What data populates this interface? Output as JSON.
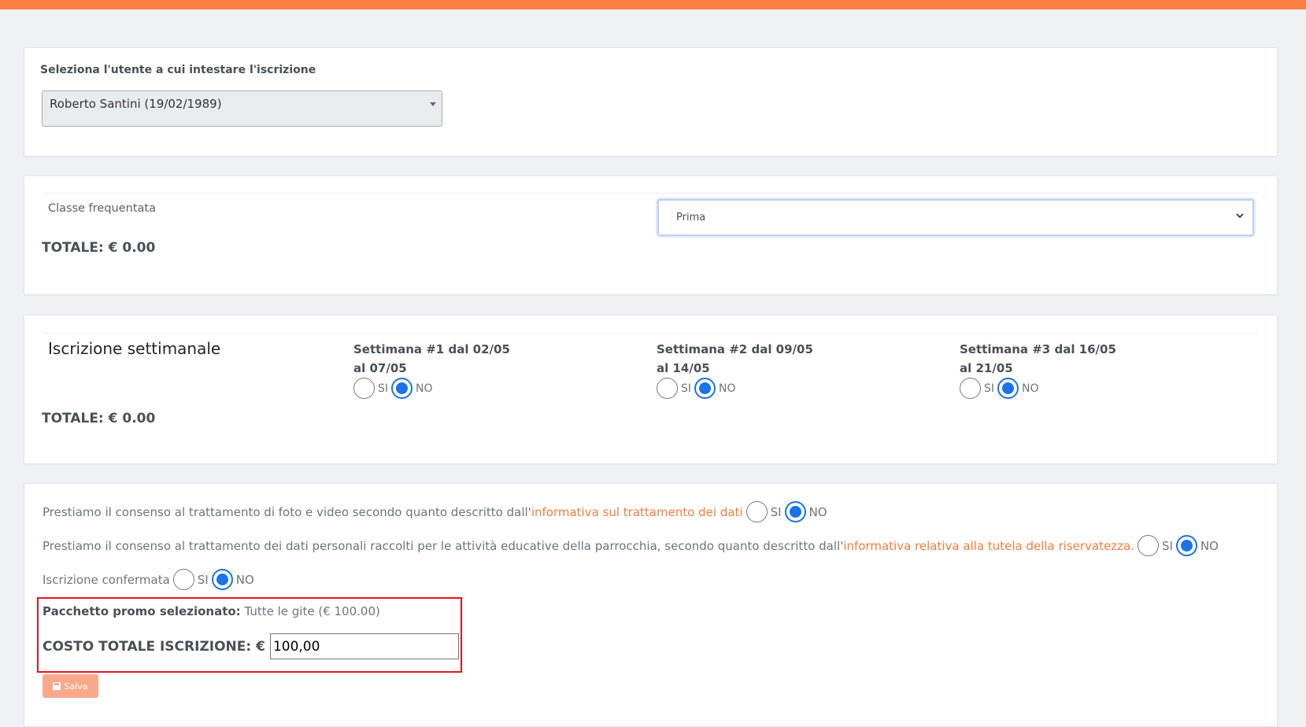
{
  "header": {
    "accent": "#fd7e42"
  },
  "user_section": {
    "label": "Seleziona l'utente a cui intestare l'iscrizione",
    "selected_user": "Roberto Santini (19/02/1989)"
  },
  "class_section": {
    "label": "Classe frequentata",
    "selected": "Prima",
    "total": "TOTALE: € 0.00"
  },
  "weekly_section": {
    "title": "Iscrizione settimanale",
    "weeks": [
      {
        "line1": "Settimana #1 dal 02/05",
        "line2": "al 07/05",
        "yes": "SI",
        "no": "NO",
        "selected": "NO"
      },
      {
        "line1": "Settimana #2 dal 09/05",
        "line2": "al 14/05",
        "yes": "SI",
        "no": "NO",
        "selected": "NO"
      },
      {
        "line1": "Settimana #3 dal 16/05",
        "line2": "al 21/05",
        "yes": "SI",
        "no": "NO",
        "selected": "NO"
      }
    ],
    "total": "TOTALE: € 0.00"
  },
  "consents": {
    "photo": {
      "text": "Prestiamo il consenso al trattamento di foto e video secondo quanto descritto dall'",
      "link": "informativa sul trattamento dei dati",
      "yes": "SI",
      "no": "NO",
      "selected": "NO"
    },
    "personal": {
      "text": "Prestiamo il consenso al trattamento dei dati personali raccolti per le attività educative della parrocchia, secondo quanto descritto dall'",
      "link": "informativa relativa alla tutela della riservatezza.",
      "yes": "SI",
      "no": "NO",
      "selected": "NO"
    },
    "confirmed": {
      "text": "Iscrizione confermata",
      "yes": "SI",
      "no": "NO",
      "selected": "NO"
    }
  },
  "summary": {
    "promo_label": "Pacchetto promo selezionato:",
    "promo_value": "Tutte le gite (€ 100.00)",
    "cost_label": "COSTO TOTALE ISCRIZIONE: €",
    "cost_value": "100,00",
    "save_label": "Salva",
    "save_icon": "floppy-disk-icon"
  }
}
